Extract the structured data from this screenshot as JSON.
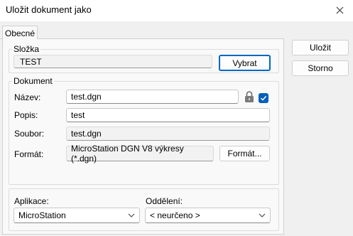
{
  "window": {
    "title": "Uložit dokument jako"
  },
  "tabs": [
    {
      "label": "Obecné"
    }
  ],
  "folder": {
    "group_label": "Složka",
    "value": "TEST",
    "browse_label": "Vybrat"
  },
  "document": {
    "group_label": "Dokument",
    "name_label": "Název:",
    "name_value": "test.dgn",
    "desc_label": "Popis:",
    "desc_value": "test",
    "file_label": "Soubor:",
    "file_value": "test.dgn",
    "format_label": "Formát:",
    "format_value": "MicroStation DGN V8 výkresy (*.dgn)",
    "format_button": "Formát..."
  },
  "app": {
    "label": "Aplikace:",
    "value": "MicroStation"
  },
  "dept": {
    "label": "Oddělení:",
    "value": "< neurčeno >"
  },
  "buttons": {
    "save": "Uložit",
    "cancel": "Storno"
  },
  "colors": {
    "accent": "#005fb8"
  },
  "icons": {
    "close": "close-icon",
    "lock": "lock-icon",
    "check": "checkmark-icon",
    "dropdown": "chevron-down-icon"
  }
}
